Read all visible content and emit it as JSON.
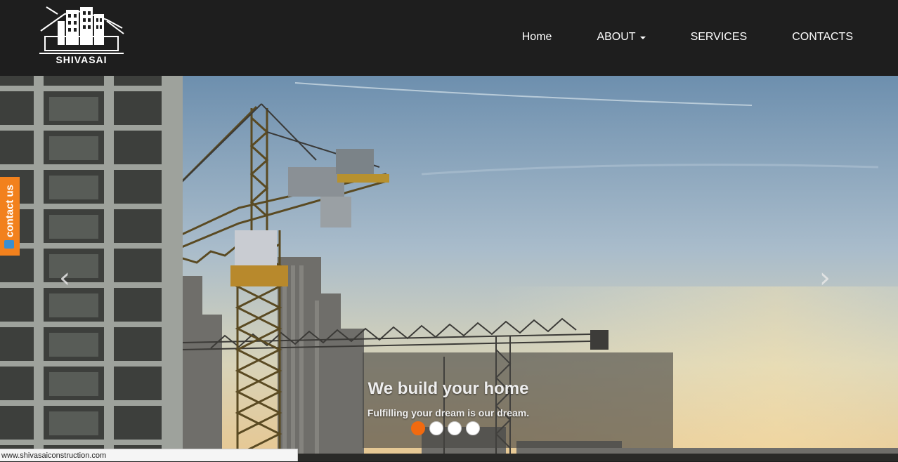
{
  "brand": {
    "name": "SHIVASAI"
  },
  "nav": {
    "items": [
      {
        "label": "Home"
      },
      {
        "label": "ABOUT"
      },
      {
        "label": "SERVICES"
      },
      {
        "label": "CONTACTS"
      }
    ]
  },
  "carousel": {
    "title": "We build your home",
    "subtitle": "Fulfilling your dream is our dream.",
    "slide_count": 4,
    "active_index": 0
  },
  "contact_tab": {
    "label": "contact us"
  },
  "status_bar": {
    "url": "www.shivasaiconstruction.com"
  },
  "colors": {
    "accent": "#f26a0f",
    "navbar": "#1e1e1e"
  }
}
